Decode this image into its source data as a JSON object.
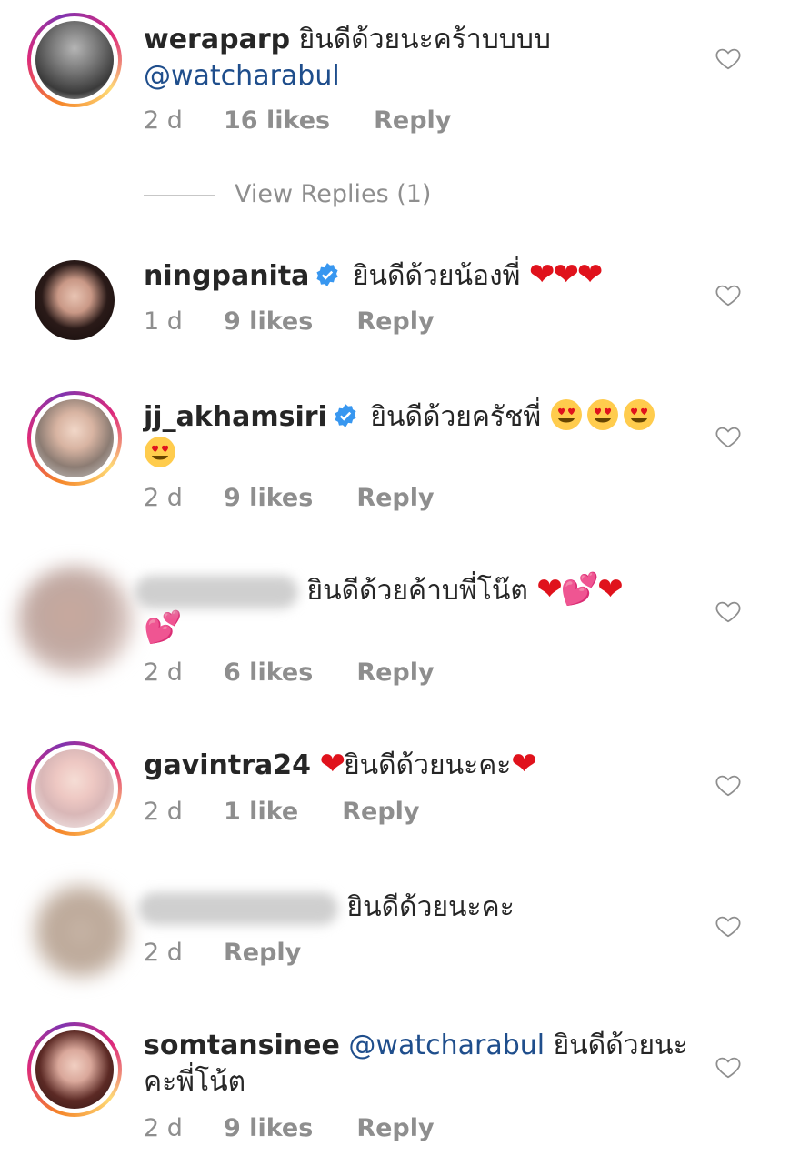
{
  "comments": [
    {
      "username": "weraparp",
      "text": "ยินดีด้วยนะคร้าบบบบ",
      "mention": "@watcharabul",
      "time": "2 d",
      "likes": "16 likes",
      "reply": "Reply"
    },
    {
      "username": "ningpanita",
      "text": "ยินดีด้วยน้องพี่",
      "emoji": "❤❤❤",
      "time": "1 d",
      "likes": "9 likes",
      "reply": "Reply"
    },
    {
      "username": "jj_akhamsiri",
      "text": "ยินดีด้วยครัชพี่",
      "time": "2 d",
      "likes": "9 likes",
      "reply": "Reply"
    },
    {
      "text": "ยินดีด้วยค้าบพี่โน๊ต",
      "emoji": "❤💕❤",
      "emoji2": "💕",
      "time": "2 d",
      "likes": "6 likes",
      "reply": "Reply"
    },
    {
      "username": "gavintra24",
      "text": "ยินดีด้วยนะคะ",
      "emoji": "❤",
      "time": "2 d",
      "likes": "1 like",
      "reply": "Reply"
    },
    {
      "text": "ยินดีด้วยนะคะ",
      "time": "2 d",
      "reply": "Reply"
    },
    {
      "username": "somtansinee",
      "mention": "@watcharabul",
      "text": "ยินดีด้วยนะ",
      "text2": "คะพี่โน้ต",
      "time": "2 d",
      "likes": "9 likes",
      "reply": "Reply"
    }
  ],
  "view_replies": "View Replies (1)",
  "icons": {
    "like": "heart-outline-icon",
    "verified": "verified-badge-icon",
    "emoji_heart_eyes": "heart-eyes-emoji"
  },
  "colors": {
    "mention": "#1f4e8c",
    "meta": "#8e8e8e",
    "verified": "#3897f0",
    "heart": "#e0121c"
  }
}
